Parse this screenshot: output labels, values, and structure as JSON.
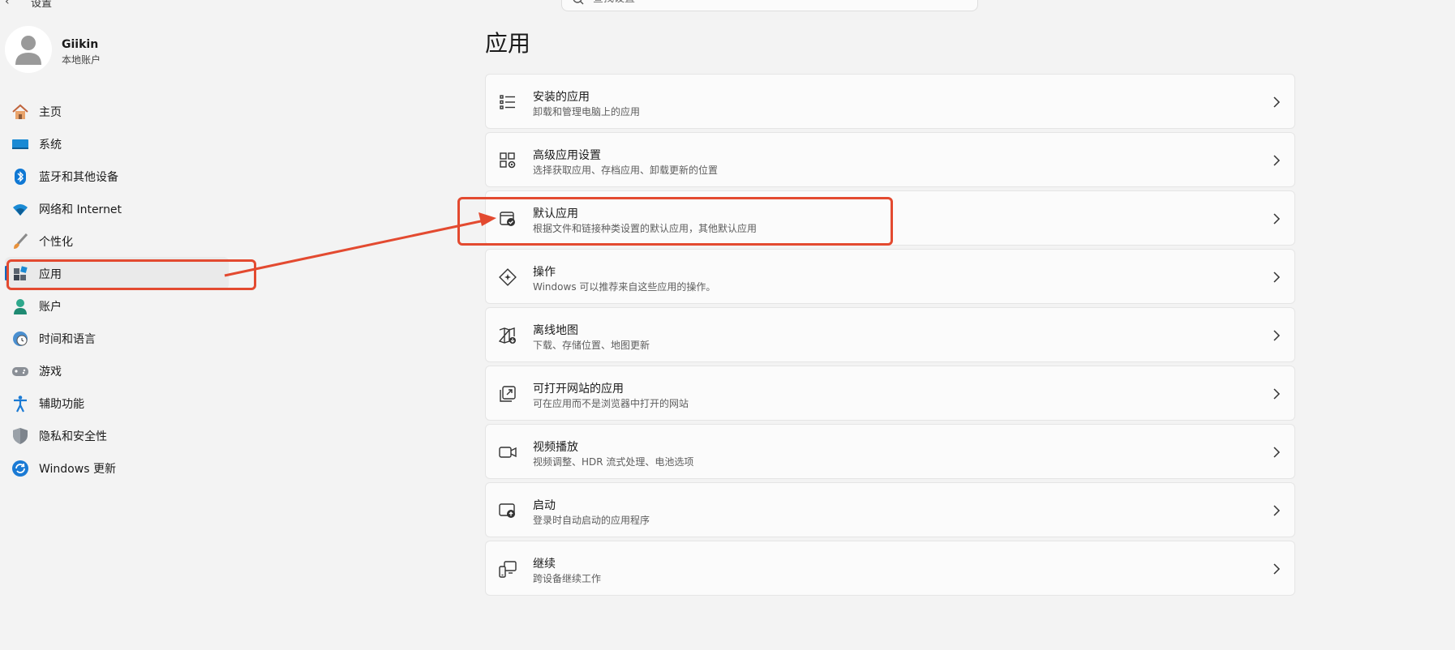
{
  "window": {
    "title": "设置"
  },
  "search": {
    "placeholder": "查找设置"
  },
  "profile": {
    "name": "Giikin",
    "account_type": "本地账户"
  },
  "sidebar": {
    "items": [
      {
        "label": "主页",
        "icon": "home-icon"
      },
      {
        "label": "系统",
        "icon": "system-icon"
      },
      {
        "label": "蓝牙和其他设备",
        "icon": "bluetooth-icon"
      },
      {
        "label": "网络和 Internet",
        "icon": "wifi-icon"
      },
      {
        "label": "个性化",
        "icon": "brush-icon"
      },
      {
        "label": "应用",
        "icon": "apps-icon",
        "active": true
      },
      {
        "label": "账户",
        "icon": "account-icon"
      },
      {
        "label": "时间和语言",
        "icon": "time-language-icon"
      },
      {
        "label": "游戏",
        "icon": "gamepad-icon"
      },
      {
        "label": "辅助功能",
        "icon": "accessibility-icon"
      },
      {
        "label": "隐私和安全性",
        "icon": "shield-icon"
      },
      {
        "label": "Windows 更新",
        "icon": "update-icon"
      }
    ]
  },
  "main": {
    "title": "应用",
    "cards": [
      {
        "title": "安装的应用",
        "subtitle": "卸载和管理电脑上的应用",
        "icon": "list-icon"
      },
      {
        "title": "高级应用设置",
        "subtitle": "选择获取应用、存档应用、卸载更新的位置",
        "icon": "advanced-apps-icon"
      },
      {
        "title": "默认应用",
        "subtitle": "根据文件和链接种类设置的默认应用，其他默认应用",
        "icon": "default-apps-icon"
      },
      {
        "title": "操作",
        "subtitle": "Windows 可以推荐来自这些应用的操作。",
        "icon": "actions-icon"
      },
      {
        "title": "离线地图",
        "subtitle": "下载、存储位置、地图更新",
        "icon": "map-icon"
      },
      {
        "title": "可打开网站的应用",
        "subtitle": "可在应用而不是浏览器中打开的网站",
        "icon": "open-web-icon"
      },
      {
        "title": "视频播放",
        "subtitle": "视频调整、HDR 流式处理、电池选项",
        "icon": "video-icon"
      },
      {
        "title": "启动",
        "subtitle": "登录时自动启动的应用程序",
        "icon": "startup-icon"
      },
      {
        "title": "继续",
        "subtitle": "跨设备继续工作",
        "icon": "continue-icon"
      }
    ]
  },
  "colors": {
    "accent": "#0067c0",
    "annotation": "#e34a30",
    "background": "#f3f3f3",
    "card": "#fbfbfb"
  }
}
